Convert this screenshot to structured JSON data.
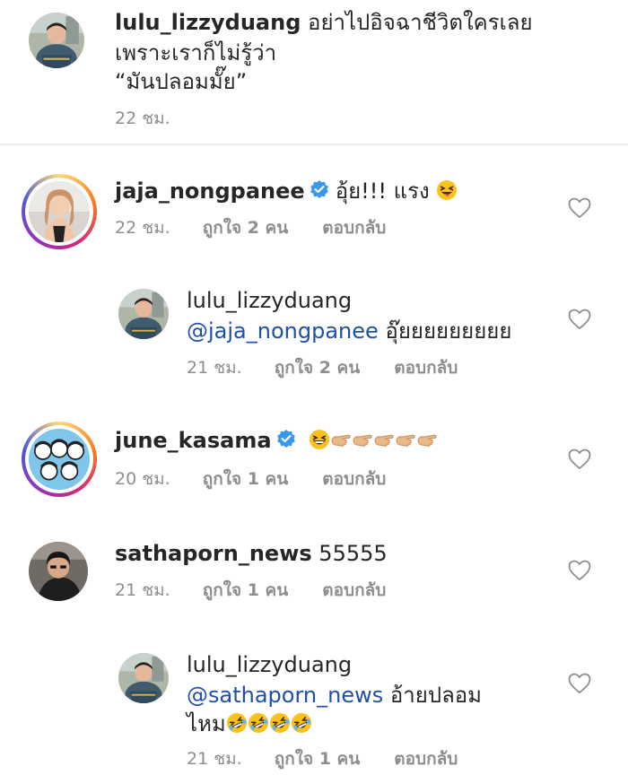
{
  "caption": {
    "username": "lulu_lizzyduang",
    "line1": "อย่าไปอิจฉาชีวิตใครเลย",
    "line2": "เพราะเราก็ไม่รู้ว่า",
    "line3": "“มันปลอมมั๊ย”",
    "time": "22 ชม."
  },
  "comments": [
    {
      "username": "jaja_nongpanee",
      "verified": true,
      "text": "อุ้ย!!! แรง",
      "emoji": "squinting-tongue-face",
      "time": "22 ชม.",
      "likes": "ถูกใจ 2 คน",
      "reply": "ตอบกลับ"
    },
    {
      "username": "lulu_lizzyduang",
      "mention": "@jaja_nongpanee",
      "text": "อุ๊ยยยยยยยยย",
      "time": "21 ชม.",
      "likes": "ถูกใจ 2 คน",
      "reply": "ตอบกลับ"
    },
    {
      "username": "june_kasama",
      "verified": true,
      "emoji": "grinning-squint-face, pointing-hand x5",
      "time": "20 ชม.",
      "likes": "ถูกใจ 1 คน",
      "reply": "ตอบกลับ"
    },
    {
      "username": "sathaporn_news",
      "text": "55555",
      "time": "21 ชม.",
      "likes": "ถูกใจ 1 คน",
      "reply": "ตอบกลับ"
    },
    {
      "username": "lulu_lizzyduang",
      "mention": "@sathaporn_news",
      "text": "อ้ายปลอม",
      "text2": "ไหม",
      "emoji": "rolling-laughing-face x4",
      "time": "21 ชม.",
      "likes": "ถูกใจ 1 คน",
      "reply": "ตอบกลับ"
    }
  ],
  "colors": {
    "mention": "#1f4fa8",
    "meta": "#8e8e8e",
    "verified": "#3897f0",
    "divider": "#ececec"
  }
}
